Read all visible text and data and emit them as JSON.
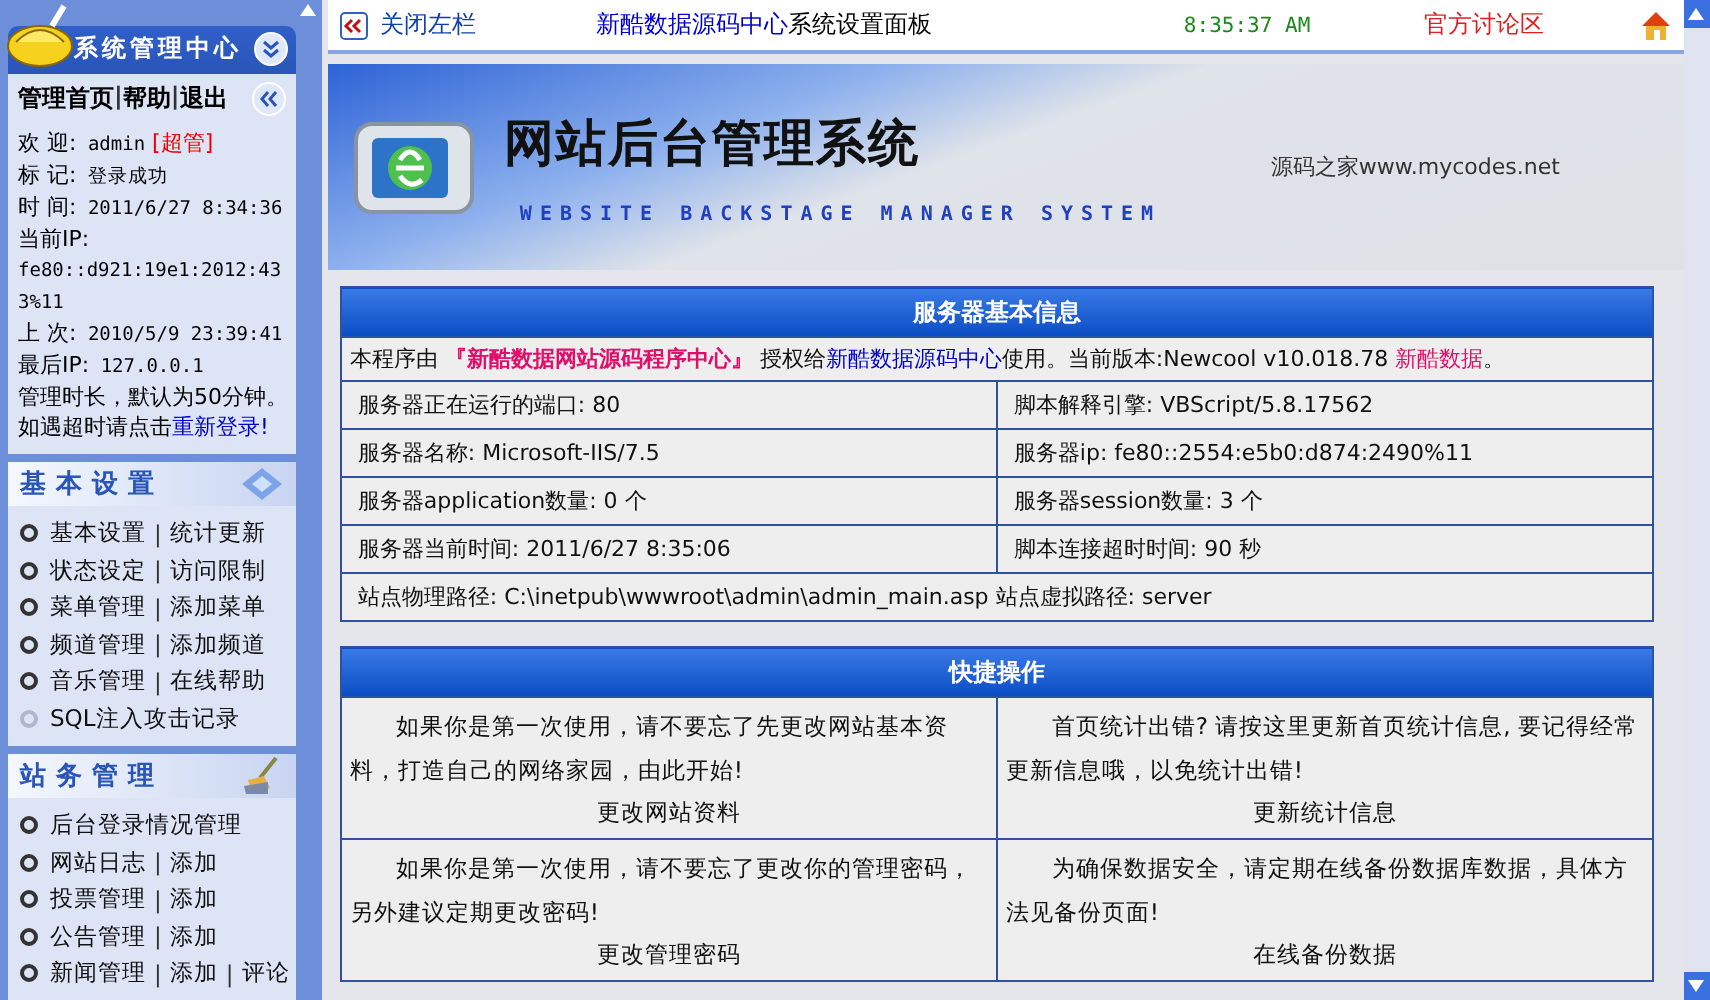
{
  "sidebar": {
    "title": "系统管理中心",
    "nav": [
      "管理首页",
      "|",
      "帮助",
      "|",
      "退出"
    ],
    "info": [
      {
        "label": "欢 迎:",
        "value": "admin",
        "tag": "[超管]"
      },
      {
        "label": "标 记:",
        "value": "登录成功"
      },
      {
        "label": "时 间:",
        "value": "2011/6/27 8:34:36"
      },
      {
        "label": "当前IP:"
      },
      {
        "value": "fe80::d921:19e1:2012:433%11"
      },
      {
        "label": "上 次:",
        "value": "2010/5/9 23:39:41"
      },
      {
        "label": "最后IP:",
        "value": "127.0.0.1"
      },
      {
        "label": "管理时长，默认为50分钟。"
      }
    ],
    "relogin": {
      "text": "如遇超时请点击",
      "link": "重新登录!"
    },
    "sections": [
      {
        "title": "基本设置",
        "kind": "settings",
        "rows": [
          {
            "muted": false,
            "parts": [
              "基本设置",
              "|",
              "统计更新"
            ]
          },
          {
            "muted": false,
            "parts": [
              "状态设定",
              "|",
              "访问限制"
            ]
          },
          {
            "muted": false,
            "parts": [
              "菜单管理",
              "|",
              "添加菜单"
            ]
          },
          {
            "muted": false,
            "parts": [
              "频道管理",
              "|",
              "添加频道"
            ]
          },
          {
            "muted": false,
            "parts": [
              "音乐管理",
              "|",
              "在线帮助"
            ]
          },
          {
            "muted": true,
            "parts": [
              "SQL注入攻击记录"
            ]
          }
        ]
      },
      {
        "title": "站务管理",
        "kind": "broom",
        "rows": [
          {
            "muted": false,
            "parts": [
              "后台登录情况管理"
            ]
          },
          {
            "muted": false,
            "parts": [
              "网站日志",
              "|",
              "添加"
            ]
          },
          {
            "muted": false,
            "parts": [
              "投票管理",
              "|",
              "添加"
            ]
          },
          {
            "muted": false,
            "parts": [
              "公告管理",
              "|",
              "添加"
            ]
          },
          {
            "muted": false,
            "parts": [
              "新闻管理",
              "|",
              "添加",
              "|",
              "评论"
            ]
          }
        ]
      }
    ]
  },
  "topbar": {
    "close_left": "关闭左栏",
    "brand": "新酷数据源码中心",
    "panel": "系统设置面板",
    "time": "8:35:37 AM",
    "forum": "官方讨论区"
  },
  "banner": {
    "title": "网站后台管理系统",
    "subtitle": "WEBSITE BACKSTAGE MANAGER SYSTEM",
    "site": "源码之家www.mycodes.net"
  },
  "server_info": {
    "title": "服务器基本信息",
    "notice": [
      {
        "kind": "text",
        "text": "本程序由 "
      },
      {
        "kind": "brand",
        "text": "『新酷数据网站源码程序中心』"
      },
      {
        "kind": "text",
        "text": " 授权给"
      },
      {
        "kind": "link",
        "text": "新酷数据源码中心"
      },
      {
        "kind": "text",
        "text": "使用。当前版本:Newcool v10.018.78 "
      },
      {
        "kind": "brand-plain",
        "text": "新酷数据"
      },
      {
        "kind": "text",
        "text": "。"
      }
    ],
    "rows": [
      [
        "服务器正在运行的端口: 80",
        "脚本解释引擎: VBScript/5.8.17562"
      ],
      [
        "服务器名称: Microsoft-IIS/7.5",
        "服务器ip: fe80::2554:e5b0:d874:2490%11"
      ],
      [
        "服务器application数量: 0 个",
        "服务器session数量: 3 个"
      ],
      [
        "服务器当前时间: 2011/6/27 8:35:06",
        "脚本连接超时时间: 90 秒"
      ]
    ],
    "path": "站点物理路径: C:\\inetpub\\wwwroot\\admin\\admin_main.asp 站点虚拟路径: server"
  },
  "quick_ops": {
    "title": "快捷操作",
    "cells": [
      {
        "text": "如果你是第一次使用，请不要忘了先更改网站基本资料，打造自己的网络家园，由此开始!",
        "link": "更改网站资料"
      },
      {
        "text": "首页统计出错? 请按这里更新首页统计信息, 要记得经常更新信息哦，以免统计出错!",
        "link": "更新统计信息"
      },
      {
        "text": "如果你是第一次使用，请不要忘了更改你的管理密码，另外建议定期更改密码!",
        "link": "更改管理密码"
      },
      {
        "text": "为确保数据安全，请定期在线备份数据库数据，具体方法见备份页面!",
        "link": "在线备份数据"
      }
    ]
  }
}
